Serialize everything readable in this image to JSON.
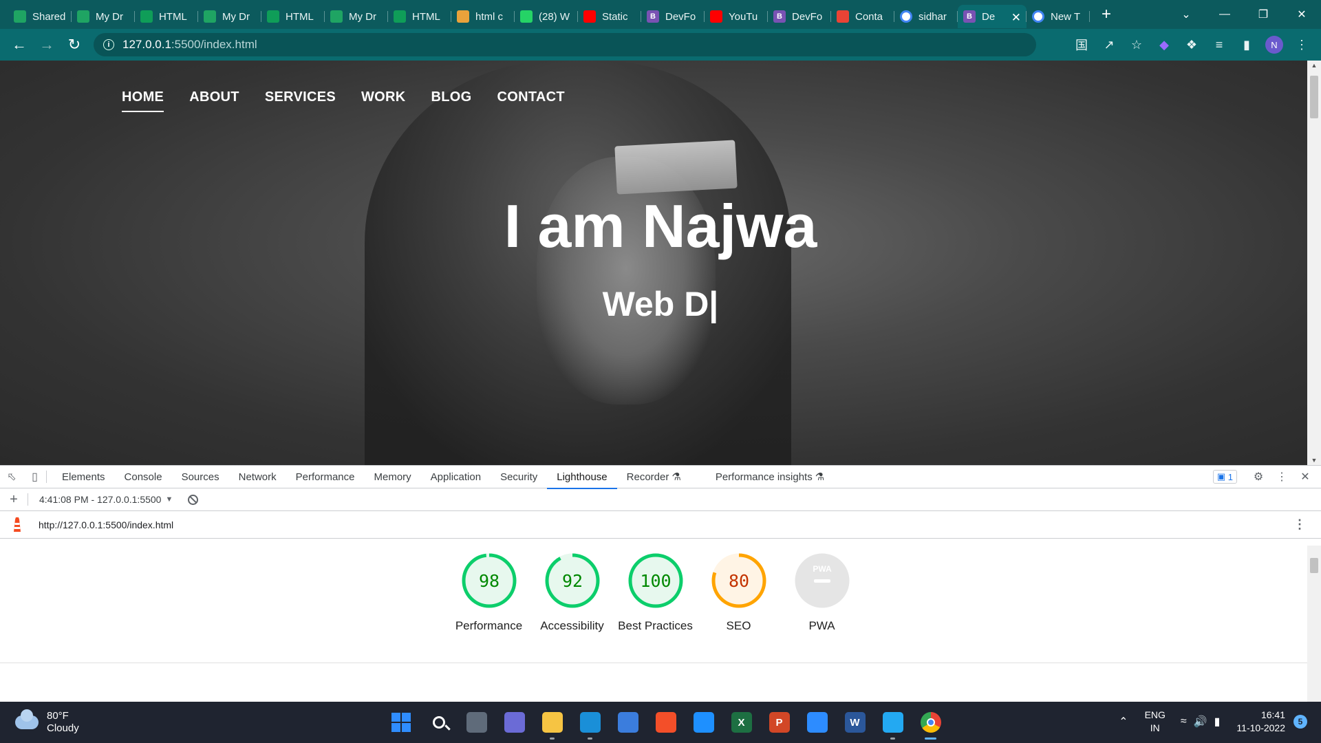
{
  "browser": {
    "tabs": [
      {
        "label": "Shared",
        "icon": "google-drive-icon",
        "color": "#1fa463"
      },
      {
        "label": "My Dr",
        "icon": "google-drive-icon",
        "color": "#1fa463"
      },
      {
        "label": "HTML",
        "icon": "google-sheets-icon",
        "color": "#0f9d58"
      },
      {
        "label": "My Dr",
        "icon": "google-drive-icon",
        "color": "#1fa463"
      },
      {
        "label": "HTML",
        "icon": "google-sheets-icon",
        "color": "#0f9d58"
      },
      {
        "label": "My Dr",
        "icon": "google-drive-icon",
        "color": "#1fa463"
      },
      {
        "label": "HTML",
        "icon": "google-sheets-icon",
        "color": "#0f9d58"
      },
      {
        "label": "html c",
        "icon": "site-icon",
        "color": "#e9a23b"
      },
      {
        "label": "(28) W",
        "icon": "whatsapp-icon",
        "color": "#25d366"
      },
      {
        "label": "Static",
        "icon": "youtube-icon",
        "color": "#ff0000"
      },
      {
        "label": "DevFo",
        "icon": "bootstrap-icon",
        "color": "#7952b3"
      },
      {
        "label": "YouTu",
        "icon": "youtube-icon",
        "color": "#ff0000"
      },
      {
        "label": "DevFo",
        "icon": "bootstrap-icon",
        "color": "#7952b3"
      },
      {
        "label": "Conta",
        "icon": "gmail-icon",
        "color": "#ea4335"
      },
      {
        "label": "sidhar",
        "icon": "google-icon",
        "color": "#ffffff"
      },
      {
        "label": "De",
        "icon": "bootstrap-icon",
        "color": "#7952b3",
        "active": true
      },
      {
        "label": "New T",
        "icon": "chrome-icon",
        "color": "#ffffff"
      }
    ],
    "url_host": "127.0.0.1",
    "url_path": ":5500/index.html"
  },
  "site": {
    "nav": [
      "HOME",
      "ABOUT",
      "SERVICES",
      "WORK",
      "BLOG",
      "CONTACT"
    ],
    "active_nav": "HOME",
    "hero_title": "I am Najwa",
    "hero_subtitle": "Web D|"
  },
  "devtools": {
    "tabs": [
      "Elements",
      "Console",
      "Sources",
      "Network",
      "Performance",
      "Memory",
      "Application",
      "Security",
      "Lighthouse",
      "Recorder",
      "Performance insights"
    ],
    "active_tab": "Lighthouse",
    "issues_count": "1",
    "session": "4:41:08 PM - 127.0.0.1:5500",
    "report_url": "http://127.0.0.1:5500/index.html",
    "scores": [
      {
        "label": "Performance",
        "value": "98",
        "score": 0.98,
        "color": "#0cce6b",
        "text_color": "#008800",
        "bg": "#e7f8ee"
      },
      {
        "label": "Accessibility",
        "value": "92",
        "score": 0.92,
        "color": "#0cce6b",
        "text_color": "#008800",
        "bg": "#e7f8ee"
      },
      {
        "label": "Best Practices",
        "value": "100",
        "score": 1.0,
        "color": "#0cce6b",
        "text_color": "#008800",
        "bg": "#e7f8ee"
      },
      {
        "label": "SEO",
        "value": "80",
        "score": 0.8,
        "color": "#ffa400",
        "text_color": "#c33300",
        "bg": "#fff4e5"
      },
      {
        "label": "PWA",
        "value": "PWA",
        "score": 0,
        "color": "#9e9e9e",
        "text_color": "#9e9e9e",
        "bg": "#e5e5e5"
      }
    ]
  },
  "taskbar": {
    "weather_temp": "80°F",
    "weather_desc": "Cloudy",
    "apps": [
      {
        "name": "start-icon",
        "color": "#2f8dff"
      },
      {
        "name": "search-icon",
        "color": "#1f2430"
      },
      {
        "name": "task-view-icon",
        "color": "#5f6b7a"
      },
      {
        "name": "teams-chat-icon",
        "color": "#6b6bd6"
      },
      {
        "name": "file-explorer-icon",
        "color": "#f6c443",
        "running": true
      },
      {
        "name": "edge-icon",
        "color": "#1a8fd8",
        "running": true
      },
      {
        "name": "store-icon",
        "color": "#3b7ddd"
      },
      {
        "name": "git-icon",
        "color": "#f34f29"
      },
      {
        "name": "help-icon",
        "color": "#1e90ff"
      },
      {
        "name": "excel-icon",
        "color": "#1d6f42",
        "letter": "X"
      },
      {
        "name": "powerpoint-icon",
        "color": "#d24726",
        "letter": "P"
      },
      {
        "name": "zoom-icon",
        "color": "#2d8cff"
      },
      {
        "name": "word-icon",
        "color": "#2b579a",
        "letter": "W"
      },
      {
        "name": "vscode-icon",
        "color": "#23a9f2",
        "running": true
      },
      {
        "name": "chrome-icon",
        "color": "#e8453c",
        "running": true,
        "focused": true
      }
    ],
    "lang_top": "ENG",
    "lang_bottom": "IN",
    "time": "16:41",
    "date": "11-10-2022",
    "notifications": "5"
  }
}
